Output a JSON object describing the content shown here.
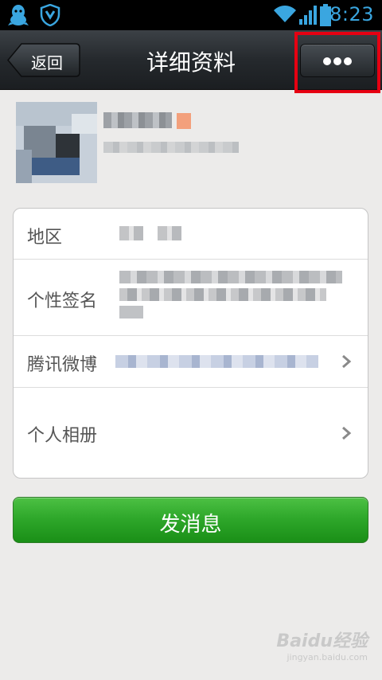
{
  "status_bar": {
    "time": "8:23",
    "icons": [
      "qq-penguin-icon",
      "shield-icon",
      "wifi-icon",
      "signal-icon",
      "battery-icon"
    ],
    "icon_color": "#3aa6e0"
  },
  "nav": {
    "back_label": "返回",
    "title": "详细资料",
    "more_icon": "more-dots-icon"
  },
  "profile": {
    "name": "",
    "subtitle": ""
  },
  "info": {
    "region_label": "地区",
    "signature_label": "个性签名",
    "weibo_label": "腾讯微博",
    "album_label": "个人相册"
  },
  "actions": {
    "send_message_label": "发消息",
    "accent_color": "#2fa82b"
  },
  "watermark": {
    "text": "Baidu经验",
    "sub": "jingyan.baidu.com"
  },
  "highlight_color": "#e60012"
}
